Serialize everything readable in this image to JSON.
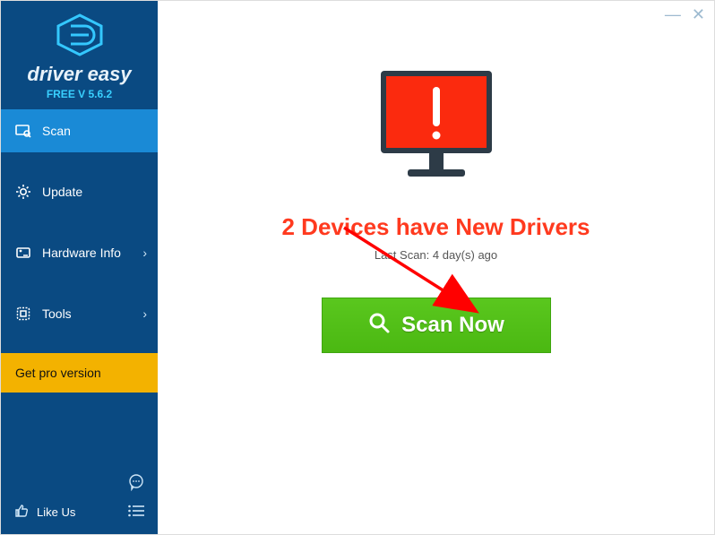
{
  "brand": {
    "name": "driver easy",
    "version_label": "FREE V 5.6.2"
  },
  "sidebar": {
    "items": [
      {
        "label": "Scan"
      },
      {
        "label": "Update"
      },
      {
        "label": "Hardware Info"
      },
      {
        "label": "Tools"
      }
    ],
    "pro_label": "Get pro version",
    "like_label": "Like Us"
  },
  "main": {
    "headline": "2 Devices have New Drivers",
    "last_scan": "Last Scan: 4 day(s) ago",
    "scan_button": "Scan Now"
  },
  "controls": {
    "minimize": "—",
    "close": "✕"
  }
}
